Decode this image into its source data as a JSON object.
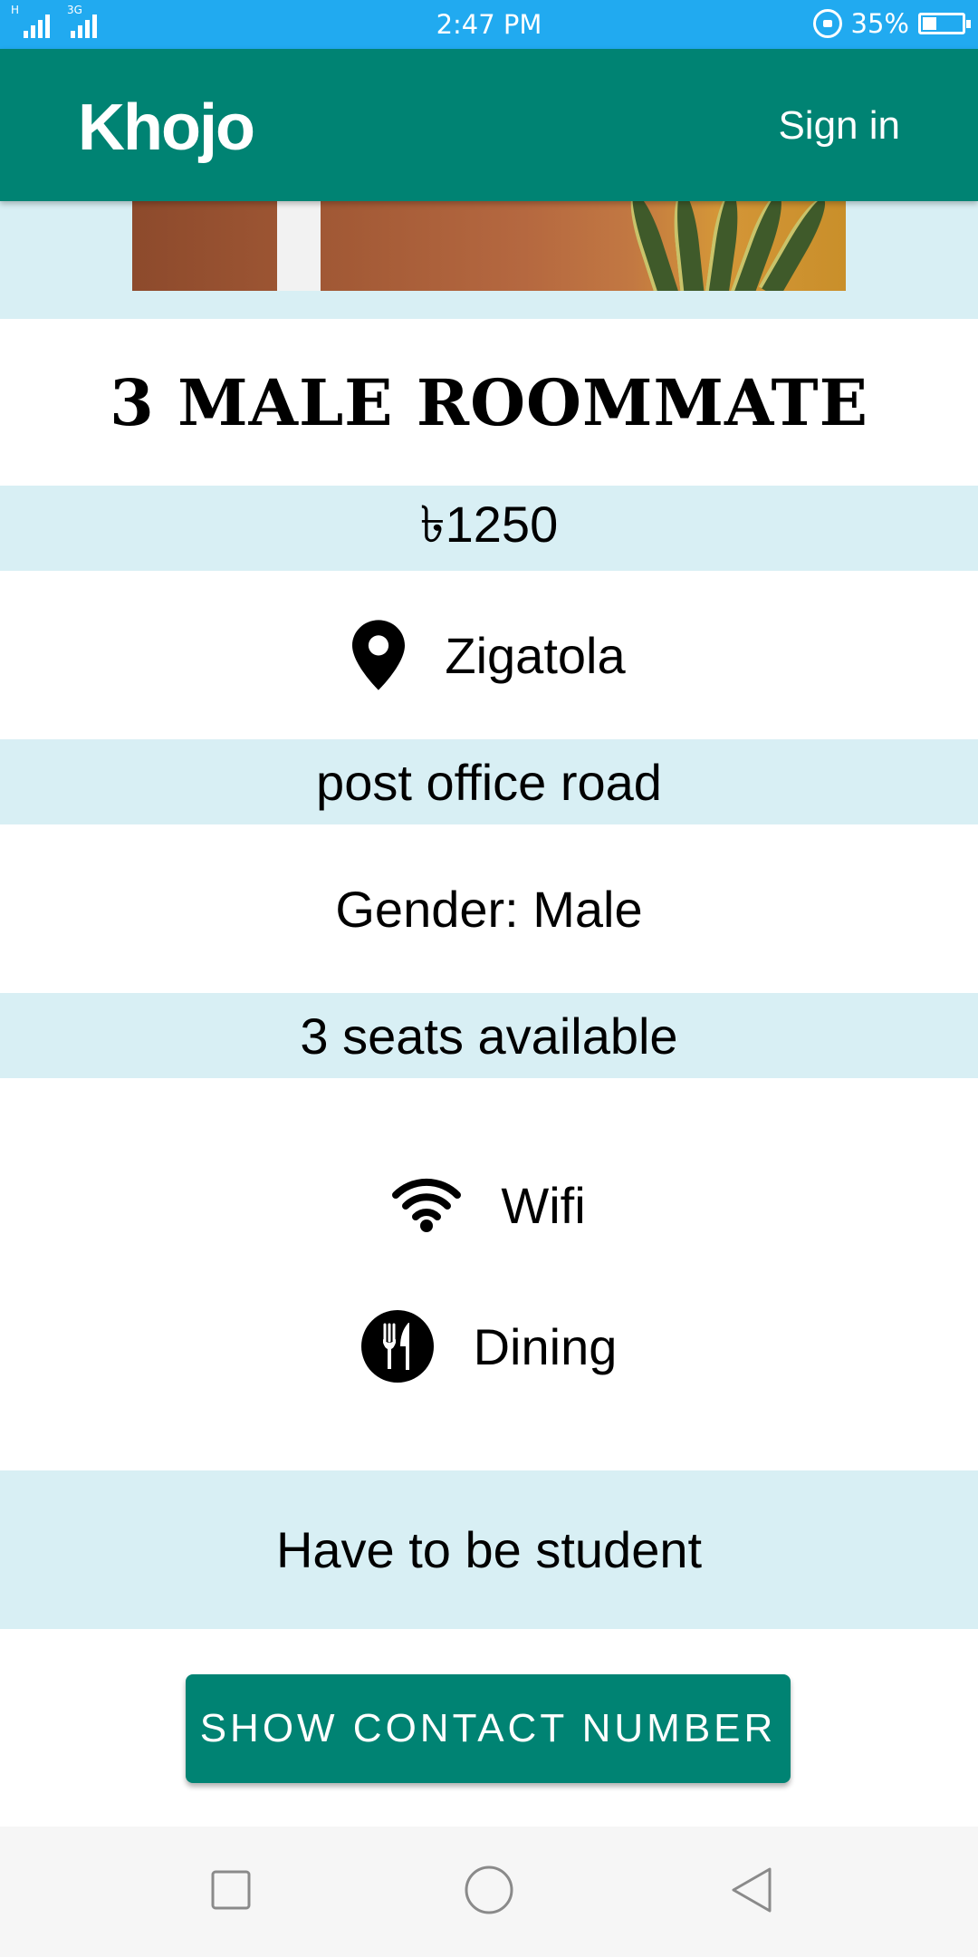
{
  "status_bar": {
    "network_left": "H",
    "network_right": "3G",
    "time": "2:47 PM",
    "battery": "35%",
    "battery_level": 0.35,
    "icons": [
      "signal-icon",
      "rotation-lock-icon",
      "battery-icon"
    ]
  },
  "app_bar": {
    "title": "Khojo",
    "sign_in": "Sign in",
    "color": "#008373"
  },
  "listing": {
    "title": "3 MALE ROOMMATE",
    "price": "৳1250",
    "location": "Zigatola",
    "address": "post office road",
    "gender": "Gender: Male",
    "seats": "3 seats available",
    "amenities": [
      {
        "icon": "wifi-icon",
        "label": "Wifi"
      },
      {
        "icon": "dining-icon",
        "label": "Dining"
      }
    ],
    "requirement": "Have to be student"
  },
  "actions": {
    "show_contact": "SHOW CONTACT NUMBER"
  },
  "colors": {
    "status_bar": "#21aaf0",
    "accent": "#008373",
    "row_tint": "#d8eff4"
  }
}
